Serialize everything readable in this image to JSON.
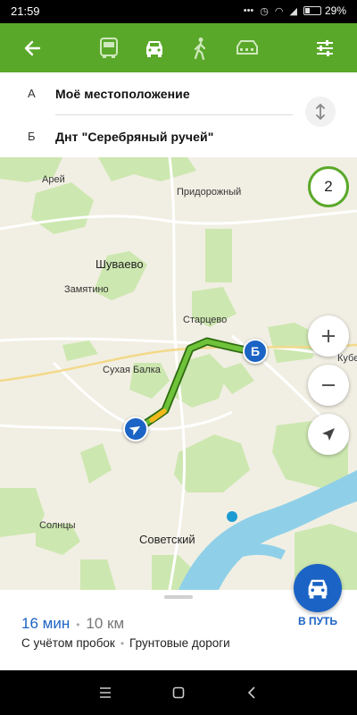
{
  "status_bar": {
    "time": "21:59",
    "battery": "29%"
  },
  "toolbar": {
    "back_icon": "arrow-left-icon",
    "modes": [
      "bus-icon",
      "car-icon",
      "walk-icon",
      "taxi-icon"
    ],
    "active_mode": "car-icon",
    "settings_icon": "sliders-icon",
    "color": "#5aa82a"
  },
  "route": {
    "from": {
      "letter": "А",
      "place": "Моё местоположение"
    },
    "to": {
      "letter": "Б",
      "place": "Днт \"Серебряный ручей\""
    },
    "swap_icon": "swap-vertical-icon"
  },
  "map": {
    "route_count": "2",
    "labels": {
      "arey": "Арей",
      "pridorozhny": "Придорожный",
      "shuvaevo": "Шуваево",
      "zamyatino": "Замятино",
      "startsevo": "Старцево",
      "sukhaya_balka": "Сухая Балка",
      "kubek": "Кубек",
      "solntsy": "Солнцы",
      "sovetsky": "Советский"
    },
    "destination_marker": "Б",
    "zoom_in_icon": "plus-icon",
    "zoom_out_icon": "minus-icon",
    "locate_icon": "navigation-arrow-icon",
    "route_color": "#5aa82a",
    "water_color": "#8fd0e8"
  },
  "summary": {
    "time": "16 мин",
    "distance": "10 км",
    "note_traffic": "С учётом пробок",
    "note_roads": "Грунтовые дороги"
  },
  "go_button": {
    "label": "В ПУТЬ",
    "icon": "car-icon",
    "color": "#1b63c5"
  },
  "nav_bar": {
    "items": [
      "menu-icon",
      "home-square-icon",
      "back-triangle-icon"
    ]
  }
}
